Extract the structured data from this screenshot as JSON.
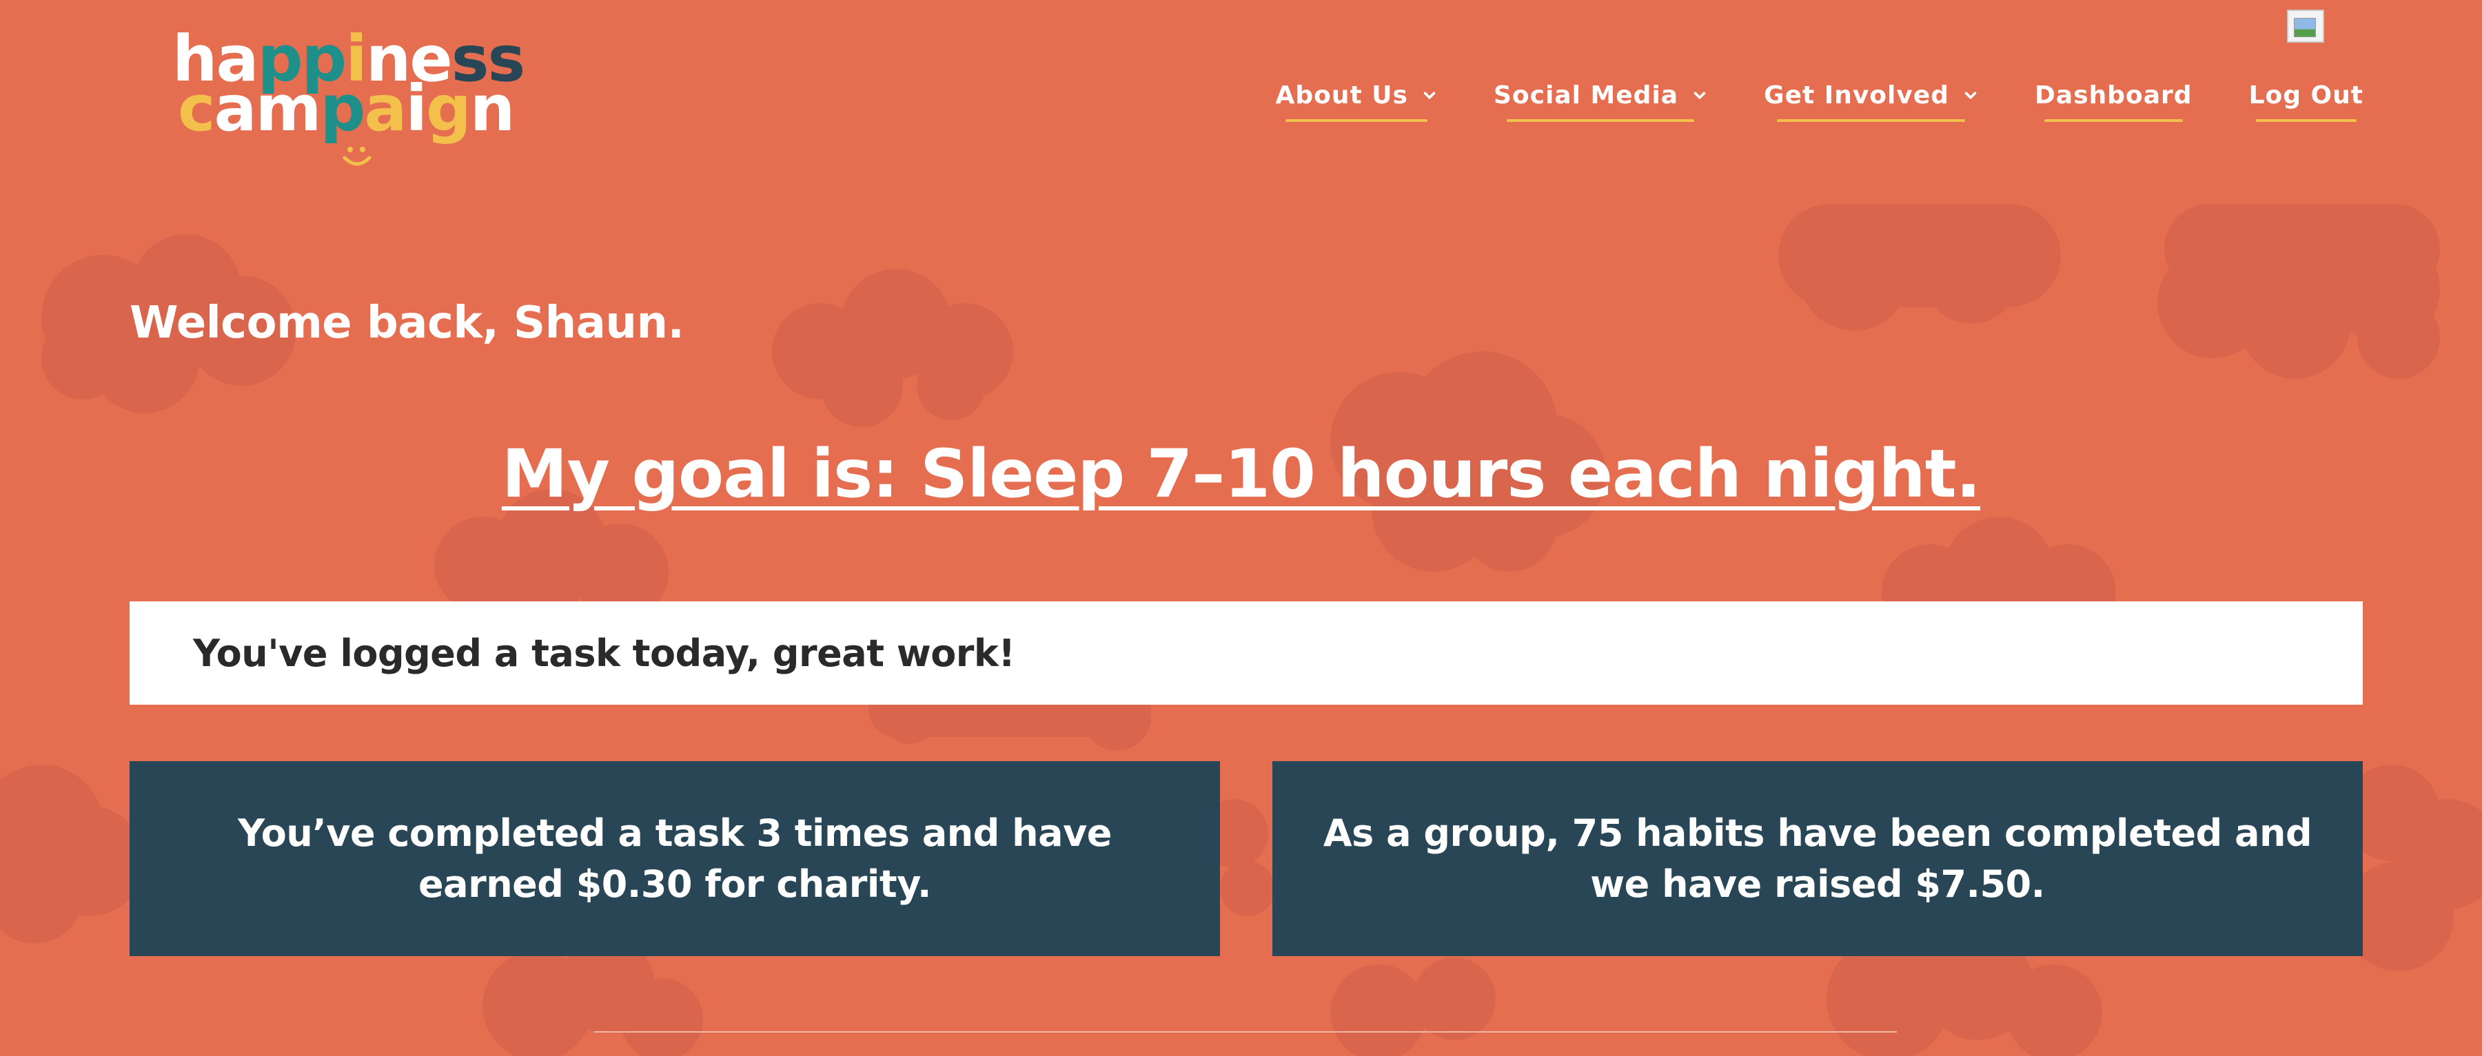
{
  "brand": {
    "logo_line1": "happiness",
    "logo_line2": "campaign",
    "logo_colors": [
      "#ffffff",
      "#f2c04b",
      "#1f8f8a",
      "#284655"
    ]
  },
  "nav": {
    "items": [
      {
        "label": "About Us",
        "has_dropdown": true
      },
      {
        "label": "Social Media",
        "has_dropdown": true
      },
      {
        "label": "Get Involved",
        "has_dropdown": true
      },
      {
        "label": "Dashboard",
        "has_dropdown": false
      },
      {
        "label": "Log Out",
        "has_dropdown": false
      }
    ],
    "underline_color": "#f2c04b"
  },
  "dashboard": {
    "welcome": "Welcome back, Shaun.",
    "goal": "My goal is: Sleep 7–10 hours each night.",
    "status_message": "You've logged a task today, great work!",
    "personal_stat": "You’ve completed a task 3 times and have earned $0.30 for charity.",
    "group_stat": "As a group, 75 habits have been completed and we have raised $7.50."
  },
  "colors": {
    "background": "#e56e51",
    "cloud": "#d9664c",
    "card": "#284655",
    "status_bg": "#ffffff"
  },
  "icons": {
    "dropdown": "chevron-down-icon",
    "broken_image": "broken-image-icon"
  }
}
